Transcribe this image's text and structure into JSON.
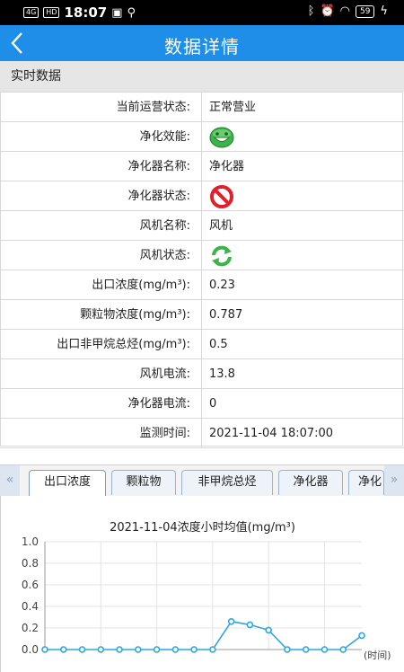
{
  "statusbar": {
    "network": "4G",
    "hd": "HD",
    "time": "18:07",
    "battery": "59"
  },
  "header": {
    "title": "数据详情"
  },
  "section": {
    "title": "实时数据"
  },
  "rows": [
    {
      "label": "当前运营状态:",
      "value": "正常营业"
    },
    {
      "label": "净化效能:",
      "icon": "green-smiley-icon"
    },
    {
      "label": "净化器名称:",
      "value": "净化器"
    },
    {
      "label": "净化器状态:",
      "icon": "red-prohibited-icon"
    },
    {
      "label": "风机名称:",
      "value": "风机"
    },
    {
      "label": "风机状态:",
      "icon": "green-refresh-icon"
    },
    {
      "label": "出口浓度(mg/m³):",
      "value": "0.23"
    },
    {
      "label": "颗粒物浓度(mg/m³):",
      "value": "0.787"
    },
    {
      "label": "出口非甲烷总烃(mg/m³):",
      "value": "0.5"
    },
    {
      "label": "风机电流:",
      "value": "13.8"
    },
    {
      "label": "净化器电流:",
      "value": "0"
    },
    {
      "label": "监测时间:",
      "value": "2021-11-04 18:07:00"
    }
  ],
  "tabs": [
    {
      "label": "出口浓度",
      "active": true
    },
    {
      "label": "颗粒物"
    },
    {
      "label": "非甲烷总烃"
    },
    {
      "label": "净化器"
    },
    {
      "label": "净化"
    }
  ],
  "colors": {
    "accent": "#1f8ee8",
    "line": "#2ea7e0",
    "ok": "#3bb54a",
    "stop": "#e0212b"
  },
  "chart_data": {
    "type": "line",
    "title": "2021-11-04浓度小时均值(mg/m³)",
    "xlabel": "(时间)",
    "ylabel": "",
    "ylim": [
      0,
      1.0
    ],
    "yticks": [
      "0.0",
      "0.2",
      "0.4",
      "0.6",
      "0.8",
      "1.0"
    ],
    "grid": true,
    "x": [
      0,
      1,
      2,
      3,
      4,
      5,
      6,
      7,
      8,
      9,
      10,
      11,
      12,
      13,
      14,
      15,
      16,
      17
    ],
    "series": [
      {
        "values": [
          0,
          0,
          0,
          0,
          0,
          0,
          0,
          0,
          0,
          0,
          0.26,
          0.23,
          0.18,
          0,
          0,
          0,
          0,
          0.13
        ]
      }
    ]
  }
}
